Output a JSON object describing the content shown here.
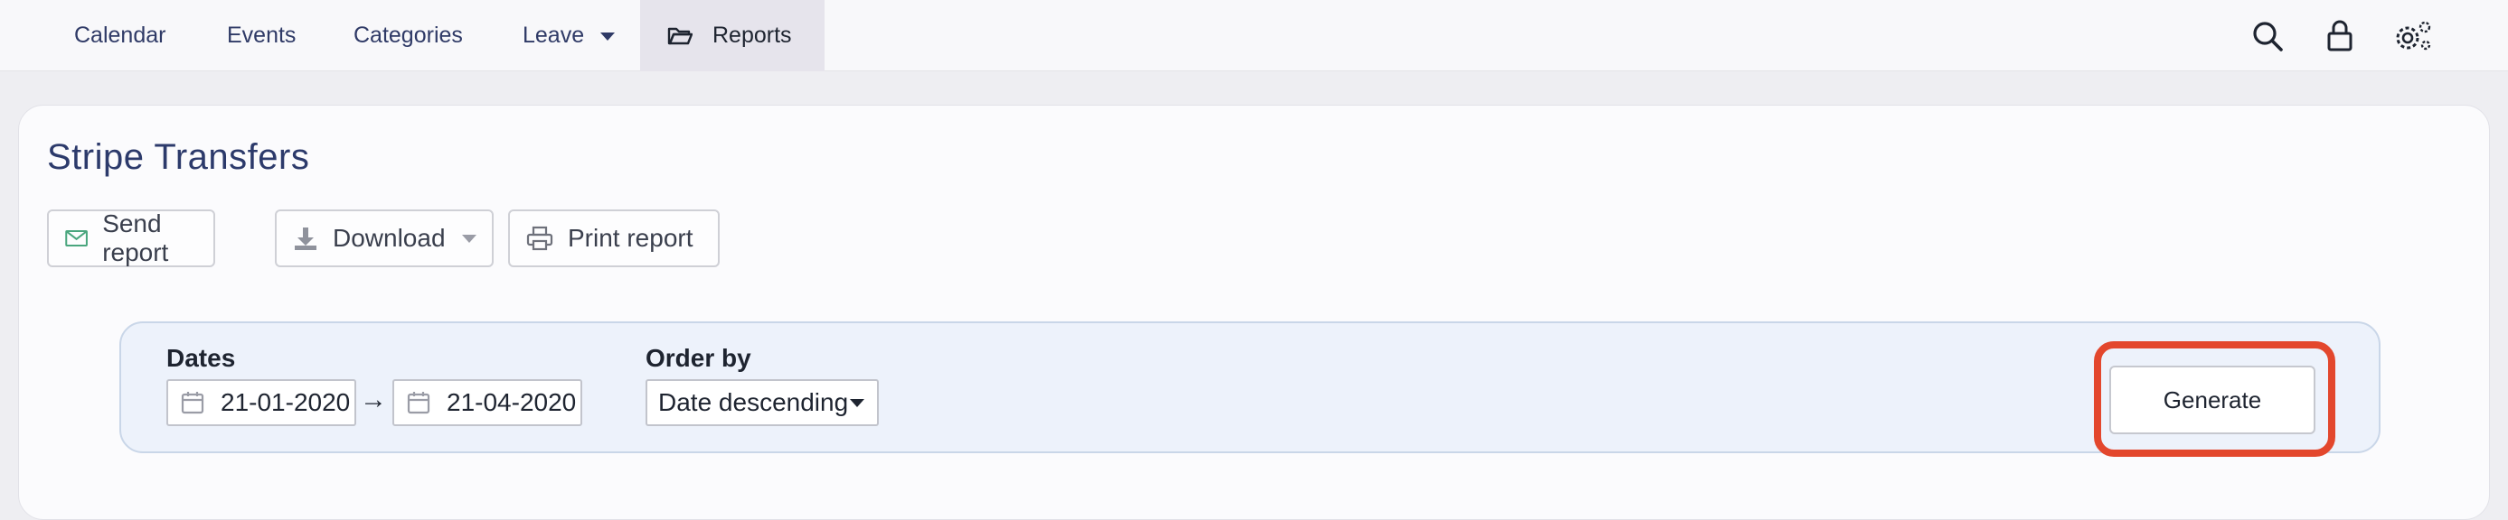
{
  "nav": {
    "items": [
      {
        "label": "Calendar"
      },
      {
        "label": "Events"
      },
      {
        "label": "Categories"
      },
      {
        "label": "Leave"
      },
      {
        "label": "Reports"
      }
    ],
    "icons": [
      "search-icon",
      "lock-icon",
      "settings-gear-icon"
    ]
  },
  "page": {
    "title": "Stripe Transfers"
  },
  "toolbar": {
    "send_label": "Send report",
    "download_label": "Download",
    "print_label": "Print report"
  },
  "filters": {
    "dates_label": "Dates",
    "date_from": "21-01-2020",
    "date_arrow": "→",
    "date_to": "21-04-2020",
    "order_label": "Order by",
    "order_value": "Date descending",
    "generate_label": "Generate"
  },
  "colors": {
    "accent": "#2c3a6b",
    "highlight": "#e3472d",
    "panel_bg": "#edf2fb",
    "active_nav_bg": "#e6e4ec"
  }
}
